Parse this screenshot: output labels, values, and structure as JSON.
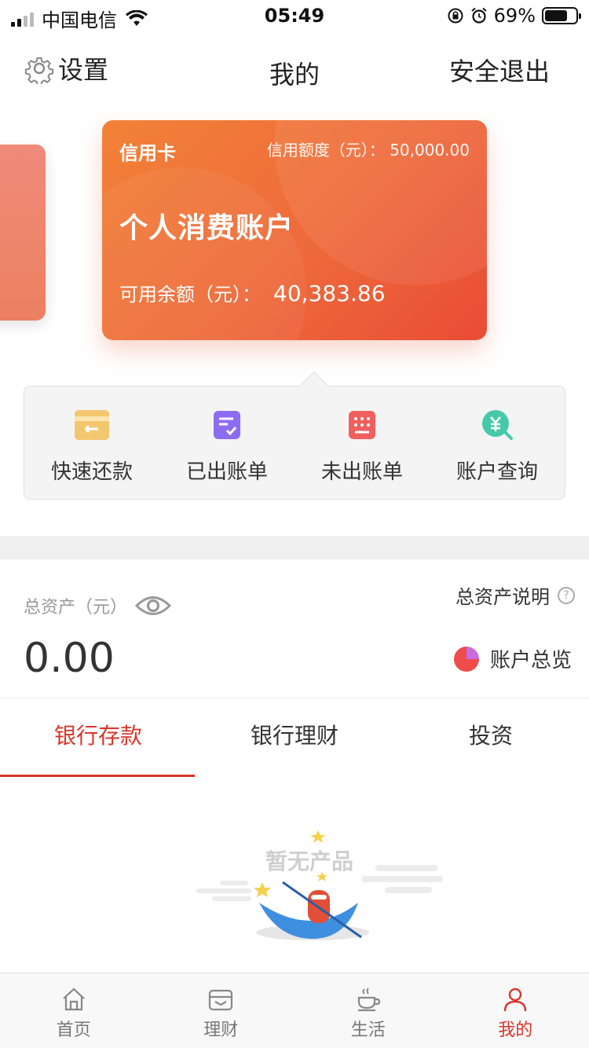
{
  "status_bar": {
    "carrier": "中国电信",
    "time": "05:49",
    "battery": "69%",
    "battery_level": 0.69
  },
  "nav": {
    "settings_label": "设置",
    "title": "我的",
    "logout_label": "安全退出"
  },
  "card": {
    "type": "信用卡",
    "limit_text": "信用额度（元）： 50,000.00",
    "name": "个人消费账户",
    "available_label": "可用余额（元）：",
    "available_value": "40,383.86"
  },
  "actions": [
    {
      "label": "快速还款",
      "icon": "repay-icon",
      "color": "#f0c060"
    },
    {
      "label": "已出账单",
      "icon": "bill-issued-icon",
      "color": "#8f6bf0"
    },
    {
      "label": "未出账单",
      "icon": "bill-pending-icon",
      "color": "#f06060"
    },
    {
      "label": "账户查询",
      "icon": "account-search-icon",
      "color": "#40c8a8"
    }
  ],
  "assets": {
    "label": "总资产（元）",
    "help": "总资产说明",
    "help_icon": "?",
    "value": "0.00",
    "overview": "账户总览"
  },
  "tabs": [
    {
      "label": "银行存款",
      "active": true
    },
    {
      "label": "银行理财",
      "active": false
    },
    {
      "label": "投资",
      "active": false
    }
  ],
  "empty_state": {
    "message": "暂无产品"
  },
  "tab_bar": [
    {
      "label": "首页",
      "icon": "home-icon",
      "active": false
    },
    {
      "label": "理财",
      "icon": "wealth-icon",
      "active": false
    },
    {
      "label": "生活",
      "icon": "coffee-icon",
      "active": false
    },
    {
      "label": "我的",
      "icon": "user-icon",
      "active": true
    }
  ],
  "colors": {
    "accent": "#d9362a",
    "card_start": "#f28237",
    "card_end": "#e94c35"
  }
}
